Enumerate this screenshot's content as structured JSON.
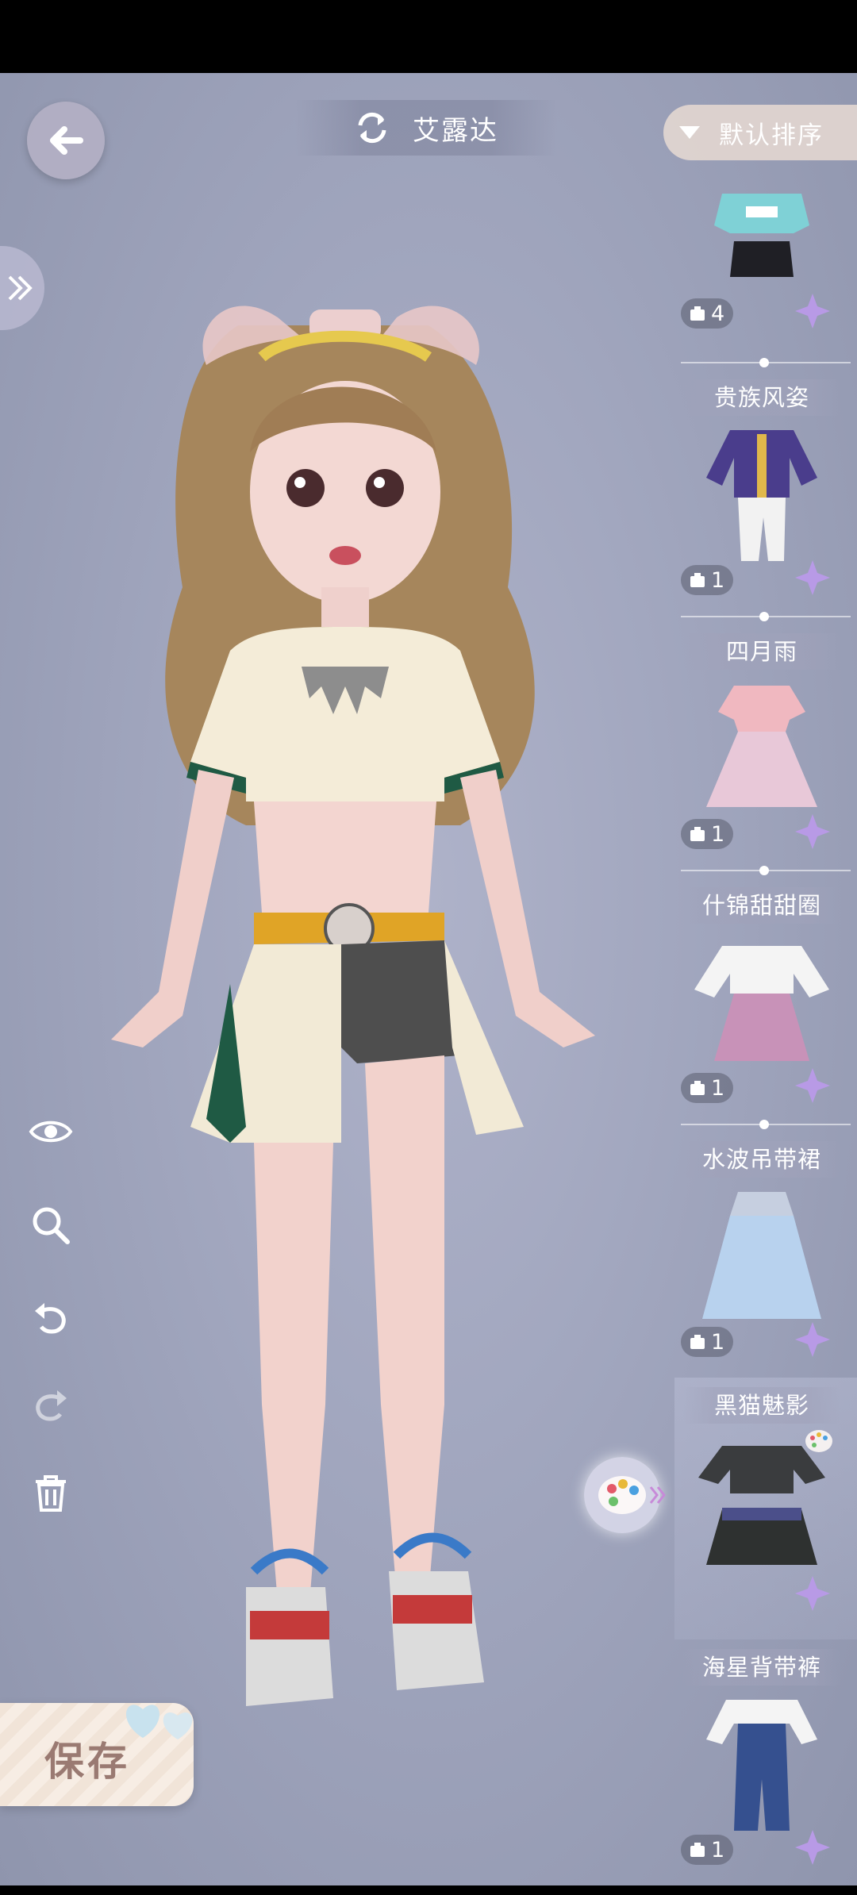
{
  "header": {
    "character_name": "艾露达",
    "sort_label": "默认排序"
  },
  "tools": [
    "eye-icon",
    "zoom-icon",
    "undo-icon",
    "redo-icon",
    "trash-icon"
  ],
  "outfits": [
    {
      "name": "",
      "count": "4"
    },
    {
      "name": "贵族风姿",
      "count": "1"
    },
    {
      "name": "四月雨",
      "count": "1"
    },
    {
      "name": "什锦甜甜圈",
      "count": "1"
    },
    {
      "name": "水波吊带裙",
      "count": "1"
    },
    {
      "name": "黑猫魅影",
      "count": "",
      "selected": true
    },
    {
      "name": "海星背带裤",
      "count": "1"
    }
  ],
  "save_label": "保存",
  "colors": {
    "background": "#a2a7bf",
    "save_text": "#9a7a72",
    "flower": "#b89ae6"
  }
}
